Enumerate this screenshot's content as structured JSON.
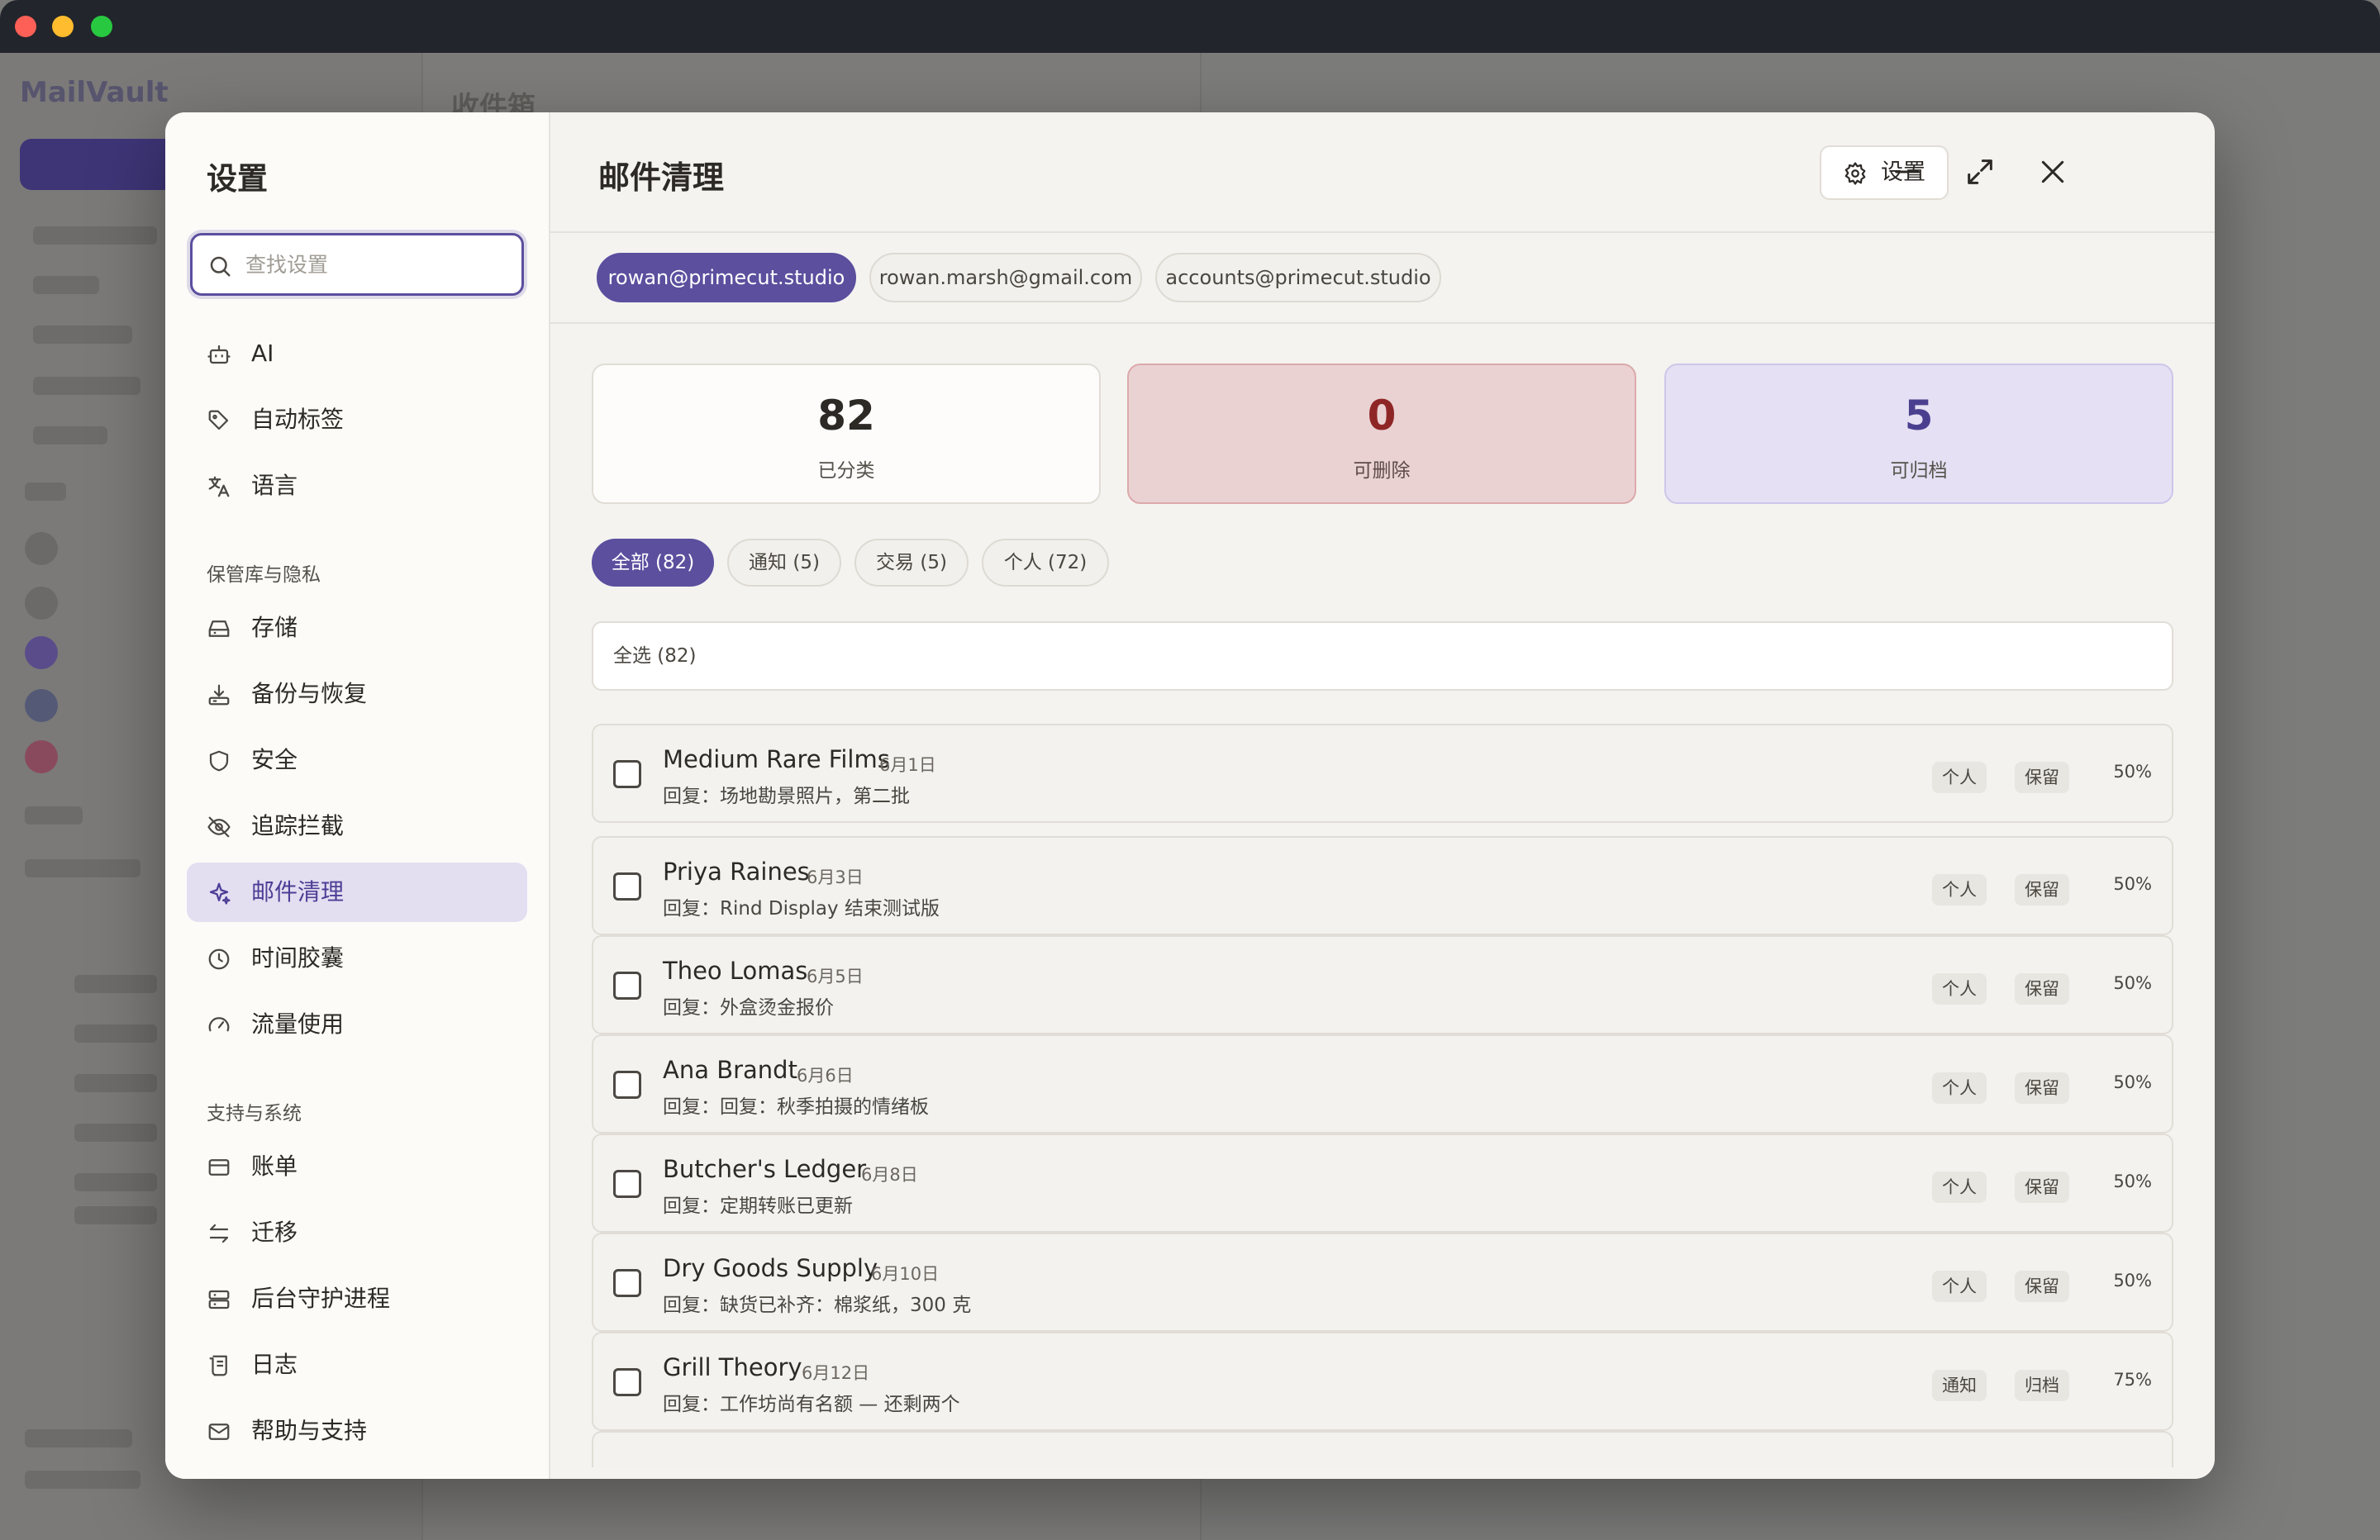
{
  "colors": {
    "accent": "#5b4f9e",
    "danger": "#8f2626",
    "active_nav_bg": "#e4def1"
  },
  "background_app": {
    "logo": "MailVault",
    "main_title": "收件箱"
  },
  "settings": {
    "title": "设置",
    "search_placeholder": "查找设置",
    "nav": [
      {
        "label": "AI",
        "icon": "robot-icon"
      },
      {
        "label": "自动标签",
        "icon": "tag-icon"
      },
      {
        "label": "语言",
        "icon": "translate-icon"
      }
    ],
    "section_privacy": "保管库与隐私",
    "nav_privacy": [
      {
        "label": "存储",
        "icon": "storage-icon"
      },
      {
        "label": "备份与恢复",
        "icon": "backup-icon"
      },
      {
        "label": "安全",
        "icon": "shield-icon"
      },
      {
        "label": "追踪拦截",
        "icon": "eye-off-icon"
      },
      {
        "label": "邮件清理",
        "icon": "sparkle-icon",
        "active": true
      },
      {
        "label": "时间胶囊",
        "icon": "clock-icon"
      },
      {
        "label": "流量使用",
        "icon": "gauge-icon"
      }
    ],
    "section_support": "支持与系统",
    "nav_support": [
      {
        "label": "账单",
        "icon": "credit-card-icon"
      },
      {
        "label": "迁移",
        "icon": "swap-arrows-icon"
      },
      {
        "label": "后台守护进程",
        "icon": "server-icon"
      },
      {
        "label": "日志",
        "icon": "log-scroll-icon"
      },
      {
        "label": "帮助与支持",
        "icon": "mail-icon"
      }
    ]
  },
  "main": {
    "title": "邮件清理",
    "settings_button": "设置",
    "accounts": [
      "rowan@primecut.studio",
      "rowan.marsh@gmail.com",
      "accounts@primecut.studio"
    ],
    "stats": [
      {
        "value": "82",
        "label": "已分类"
      },
      {
        "value": "0",
        "label": "可删除"
      },
      {
        "value": "5",
        "label": "可归档"
      }
    ],
    "filters": [
      "全部 (82)",
      "通知 (5)",
      "交易 (5)",
      "个人 (72)"
    ],
    "select_all": "全选 (82)",
    "emails": [
      {
        "sender": "Medium Rare Films",
        "date": "6月1日",
        "subject": "回复：场地勘景照片，第二批",
        "category": "个人",
        "action": "保留",
        "confidence": "50%"
      },
      {
        "sender": "Priya Raines",
        "date": "6月3日",
        "subject": "回复：Rind Display 结束测试版",
        "category": "个人",
        "action": "保留",
        "confidence": "50%"
      },
      {
        "sender": "Theo Lomas",
        "date": "6月5日",
        "subject": "回复：外盒烫金报价",
        "category": "个人",
        "action": "保留",
        "confidence": "50%"
      },
      {
        "sender": "Ana Brandt",
        "date": "6月6日",
        "subject": "回复：回复：秋季拍摄的情绪板",
        "category": "个人",
        "action": "保留",
        "confidence": "50%"
      },
      {
        "sender": "Butcher's Ledger",
        "date": "6月8日",
        "subject": "回复：定期转账已更新",
        "category": "个人",
        "action": "保留",
        "confidence": "50%"
      },
      {
        "sender": "Dry Goods Supply",
        "date": "6月10日",
        "subject": "回复：缺货已补齐：棉浆纸，300 克",
        "category": "个人",
        "action": "保留",
        "confidence": "50%"
      },
      {
        "sender": "Grill Theory",
        "date": "6月12日",
        "subject": "回复：工作坊尚有名额 — 还剩两个",
        "category": "通知",
        "action": "归档",
        "confidence": "75%"
      }
    ]
  }
}
